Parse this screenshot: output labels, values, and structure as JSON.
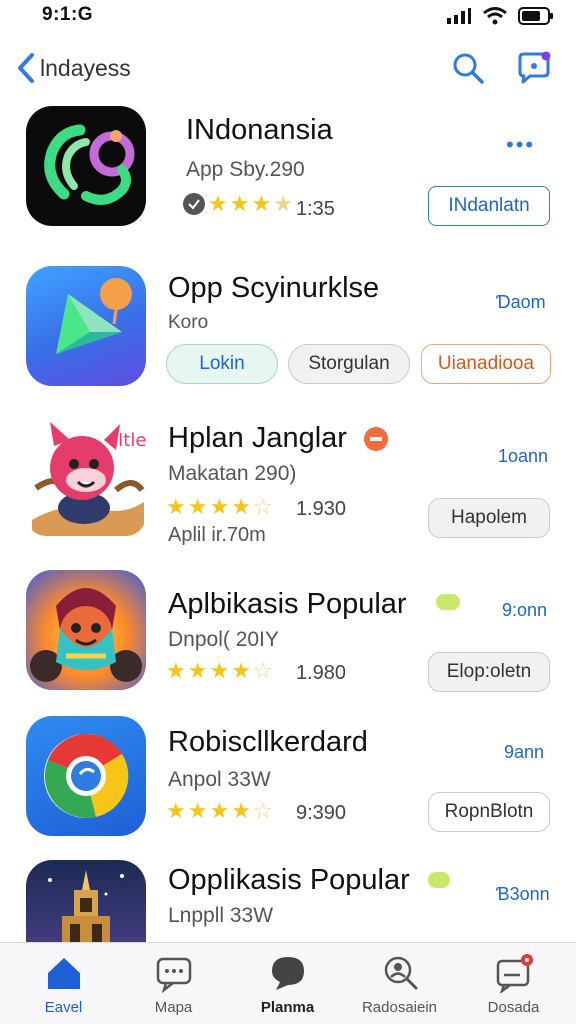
{
  "status_bar": {
    "time": "9:1:G",
    "icons": [
      "signal-icon",
      "wifi-icon",
      "battery-icon"
    ]
  },
  "nav": {
    "back_label": "lndayess",
    "search_icon": "search-icon",
    "chat_icon": "chat-icon"
  },
  "apps": [
    {
      "name": "INdonansia",
      "subtitle": "App Sby.290",
      "rating_stars": 3.5,
      "rating_value": "1:35",
      "action_label": "INdanlatn",
      "more_label": "•••"
    },
    {
      "name": "Opp Scyinurklse",
      "subtitle": "Koro",
      "tag": "Ɗaom",
      "buttons": [
        "Lokin",
        "Storgulan",
        "Uianadiooa"
      ]
    },
    {
      "name": "Hplan Janglar",
      "subtitle": "Makatan 290)",
      "subtitle2": "Aplil ir.70m",
      "rating_stars": 4.5,
      "rating_value": "1.930",
      "tag": "1oann",
      "action_label": "Hapolem"
    },
    {
      "name": "Aplbikasis Popular",
      "subtitle": "Dnpol( 20IY",
      "rating_stars": 4.5,
      "rating_value": "1.980",
      "tag": "9:onn",
      "action_label": "Elop:oletn"
    },
    {
      "name": "Robiscllkerdard",
      "subtitle": "Anpol 33W",
      "rating_stars": 4,
      "rating_value": "9:390",
      "tag": "9ann",
      "action_label": "RopnBlotn"
    },
    {
      "name": "Opplikasis Popular",
      "subtitle": "Lnppll 33W",
      "tag": "Ɓ3onn"
    }
  ],
  "tabs": [
    {
      "label": "Eavel",
      "icon": "home-icon",
      "active": true
    },
    {
      "label": "Mapa",
      "icon": "message-icon",
      "active": false
    },
    {
      "label": "Planma",
      "icon": "bubble-icon",
      "active": false
    },
    {
      "label": "Radosaiein",
      "icon": "search-person-icon",
      "active": false
    },
    {
      "label": "Dosada",
      "icon": "notification-icon",
      "active": false
    }
  ],
  "colors": {
    "accent": "#2f7be0",
    "star": "#f5c518",
    "badge_orange": "#f26b3a",
    "badge_green": "#c9e86a",
    "badge_red": "#e53935"
  }
}
